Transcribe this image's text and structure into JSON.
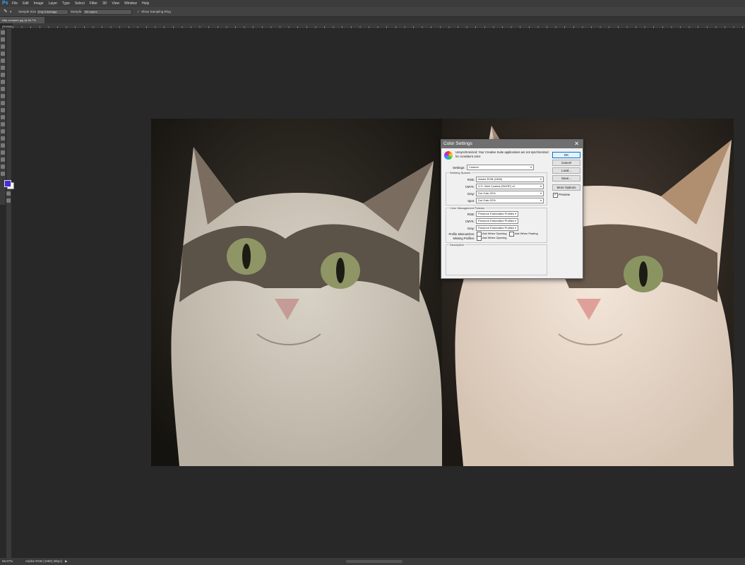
{
  "app": {
    "logo": "Ps"
  },
  "menu": [
    "File",
    "Edit",
    "Image",
    "Layer",
    "Type",
    "Select",
    "Filter",
    "3D",
    "View",
    "Window",
    "Help"
  ],
  "options": {
    "sample_size_label": "Sample Size:",
    "sample_size_value": "5 by 5 Average",
    "sample_label": "Sample:",
    "sample_value": "All Layers",
    "show_ring_label": "Show Sampling Ring"
  },
  "document": {
    "tab_title": "kitty compare.jpg @ 66.7% (RGB/8)"
  },
  "status": {
    "zoom": "66.67%",
    "profile": "Adobe RGB (1998) (8bpc)"
  },
  "colors": {
    "foreground": "#4b29e0",
    "background": "#ffffff"
  },
  "dialog": {
    "title": "Color Settings",
    "message": "Unsynchronized: Your Creative Suite applications are not synchronized for consistent color.",
    "settings_label": "Settings:",
    "settings_value": "Custom",
    "buttons": {
      "ok": "OK",
      "cancel": "Cancel",
      "load": "Load...",
      "save": "Save...",
      "more": "More Options"
    },
    "preview_label": "Preview",
    "working_spaces": {
      "title": "Working Spaces",
      "rgb_label": "RGB:",
      "rgb_value": "Adobe RGB (1998)",
      "cmyk_label": "CMYK:",
      "cmyk_value": "U.S. Web Coated (SWOP) v2",
      "gray_label": "Gray:",
      "gray_value": "Dot Gain 20%",
      "spot_label": "Spot:",
      "spot_value": "Dot Gain 20%"
    },
    "policies": {
      "title": "Color Management Policies",
      "rgb_label": "RGB:",
      "rgb_value": "Preserve Embedded Profiles",
      "cmyk_label": "CMYK:",
      "cmyk_value": "Preserve Embedded Profiles",
      "gray_label": "Gray:",
      "gray_value": "Preserve Embedded Profiles",
      "mismatch_label": "Profile Mismatches:",
      "mismatch_open": "Ask When Opening",
      "mismatch_paste": "Ask When Pasting",
      "missing_label": "Missing Profiles:",
      "missing_open": "Ask When Opening"
    },
    "description": {
      "title": "Description"
    }
  }
}
